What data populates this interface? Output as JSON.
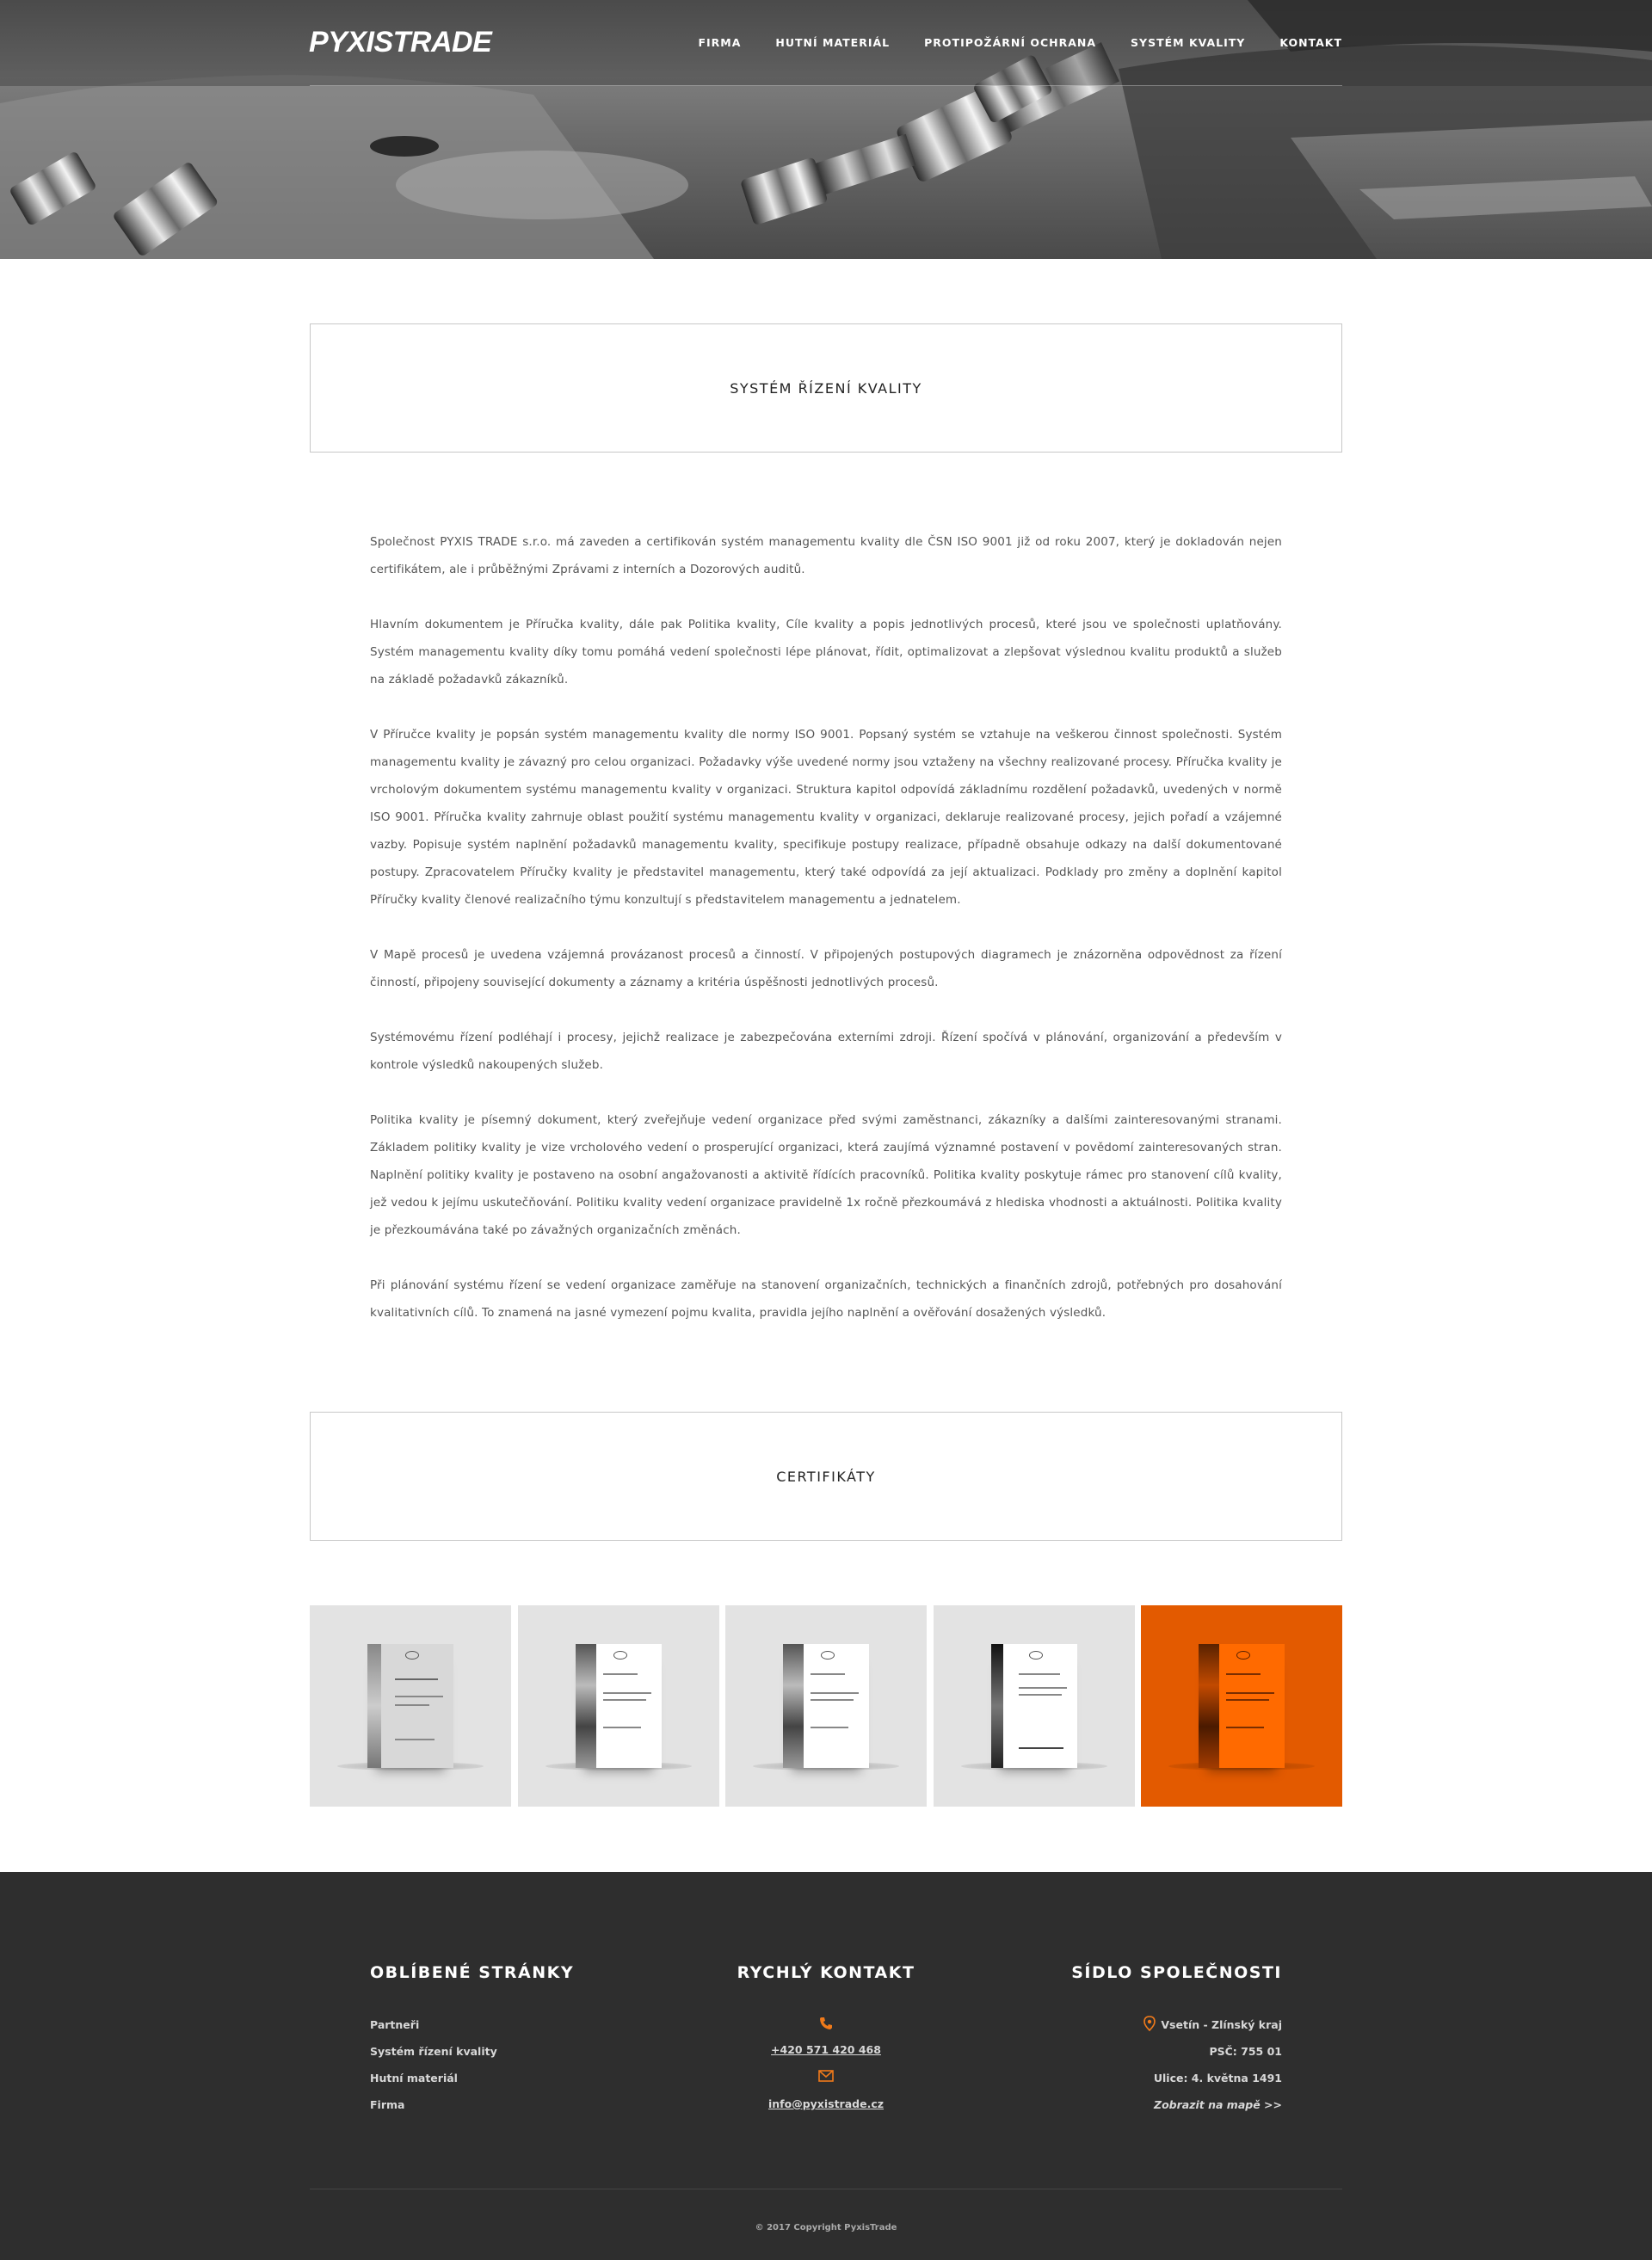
{
  "header": {
    "logo": "PYXISTRADE",
    "nav": [
      "FIRMA",
      "HUTNÍ MATERIÁL",
      "PROTIPOŽÁRNÍ OCHRANA",
      "SYSTÉM KVALITY",
      "KONTAKT"
    ]
  },
  "quality": {
    "title": "SYSTÉM ŘÍZENÍ KVALITY",
    "paragraphs": [
      "Společnost PYXIS TRADE s.r.o. má zaveden a certifikován systém managementu kvality dle ČSN ISO 9001 již od roku 2007, který je dokladován nejen certifikátem, ale i průběžnými Zprávami z interních a Dozorových auditů.",
      "Hlavním dokumentem je Příručka kvality, dále pak Politika kvality, Cíle kvality a popis jednotlivých procesů, které jsou ve společnosti uplatňovány. Systém managementu kvality díky tomu pomáhá vedení společnosti lépe plánovat, řídit, optimalizovat a zlepšovat výslednou kvalitu produktů a služeb na základě požadavků zákazníků.",
      "V Příručce kvality je popsán systém managementu kvality dle normy ISO 9001. Popsaný systém se vztahuje na veškerou činnost společnosti. Systém managementu kvality je závazný pro celou organizaci. Požadavky výše uvedené normy jsou vztaženy na všechny realizované procesy. Příručka kvality je vrcholovým dokumentem systému managementu kvality v organizaci. Struktura kapitol odpovídá základnímu rozdělení požadavků, uvedených v normě ISO 9001. Příručka kvality zahrnuje oblast použití systému managementu kvality v organizaci, deklaruje realizované procesy, jejich pořadí a vzájemné vazby. Popisuje systém naplnění požadavků managementu kvality, specifikuje postupy realizace, případně obsahuje odkazy na další dokumentované postupy. Zpracovatelem Příručky kvality je představitel managementu, který také odpovídá za její aktualizaci. Podklady pro změny a doplnění kapitol Příručky kvality členové realizačního týmu konzultují s představitelem managementu a jednatelem.",
      "V Mapě procesů je uvedena vzájemná provázanost procesů a činností. V připojených postupových diagramech je znázorněna odpovědnost za řízení činností, připojeny související dokumenty a záznamy a kritéria úspěšnosti jednotlivých procesů.",
      "Systémovému řízení podléhají i procesy, jejichž realizace je zabezpečována externími zdroji. Řízení spočívá v plánování, organizování a především v kontrole výsledků nakoupených služeb.",
      "Politika kvality je písemný dokument, který zveřejňuje vedení organizace před svými zaměstnanci, zákazníky a dalšími zainteresovanými stranami. Základem politiky kvality je vize vrcholového vedení o prosperující organizaci, která zaujímá významné postavení v povědomí zainteresovaných stran. Naplnění politiky kvality je postaveno na osobní angažovanosti a aktivitě řídících pracovníků. Politika kvality poskytuje rámec pro stanovení cílů kvality, jež vedou k jejímu uskutečňování. Politiku kvality vedení organizace pravidelně 1x ročně přezkoumává z hlediska vhodnosti a aktuálnosti. Politika kvality je přezkoumávána také po závažných organizačních změnách.",
      "Při plánování systému řízení se vedení organizace zaměřuje na stanovení organizačních, technických a finančních zdrojů, potřebných pro dosahování kvalitativních cílů. To znamená na jasné vymezení pojmu kvalita, pravidla jejího naplnění a ověřování dosažených výsledků."
    ]
  },
  "certificates": {
    "title": "CERTIFIKÁTY",
    "count": 5,
    "active_index": 4,
    "active_color": "#e35a00"
  },
  "footer": {
    "favorites_title": "OBLÍBENÉ STRÁNKY",
    "favorites": [
      "Partneři",
      "Systém řízení kvality",
      "Hutní materiál",
      "Firma"
    ],
    "contact_title": "RYCHLÝ KONTAKT",
    "phone_icon": "phone-icon",
    "phone": "+420 571 420 468",
    "mail_icon": "mail-icon",
    "email": "info@pyxistrade.cz",
    "seat_title": "SÍDLO SPOLEČNOSTI",
    "location_icon": "location-pin-icon",
    "city": "Vsetín - Zlínský kraj",
    "zip": "PSČ: 755 01",
    "street": "Ulice: 4. května 1491",
    "map_link": "Zobrazit na mapě >>",
    "copyright": "© 2017 Copyright PyxisTrade",
    "accent": "#f07a1a"
  }
}
